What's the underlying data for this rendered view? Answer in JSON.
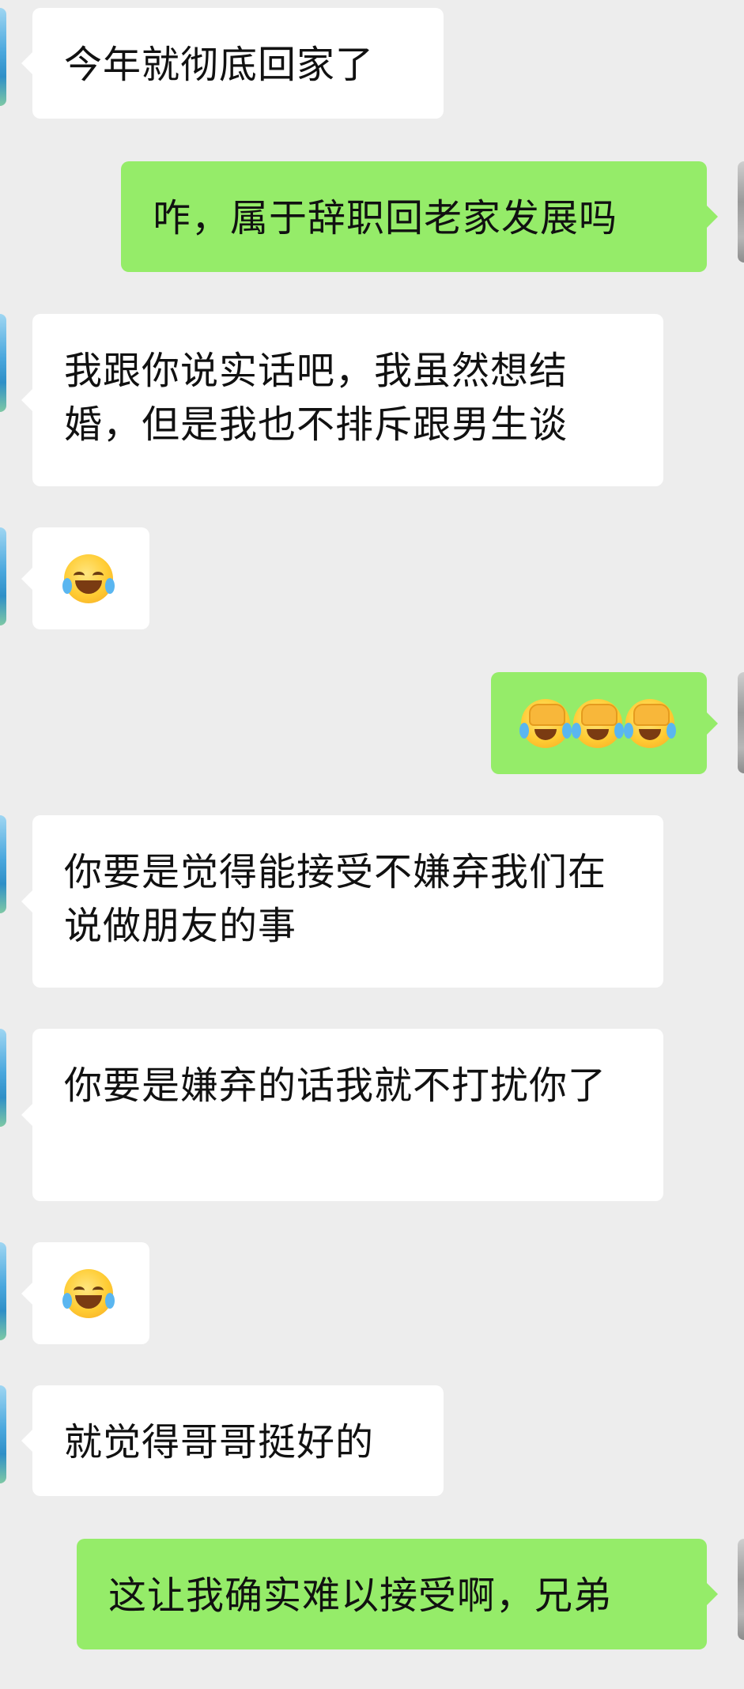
{
  "messages": [
    {
      "side": "in",
      "type": "text",
      "text": "今年就彻底回家了"
    },
    {
      "side": "out",
      "type": "text",
      "text": "咋，属于辞职回老家发展吗"
    },
    {
      "side": "in",
      "type": "text",
      "text": "我跟你说实话吧，我虽然想结婚，但是我也不排斥跟男生谈"
    },
    {
      "side": "in",
      "type": "emoji",
      "emoji": "tears-of-joy-emoji",
      "count": 1
    },
    {
      "side": "out",
      "type": "emoji",
      "emoji": "facepalm-crying-emoji",
      "count": 3
    },
    {
      "side": "in",
      "type": "text",
      "text": "你要是觉得能接受不嫌弃我们在说做朋友的事"
    },
    {
      "side": "in",
      "type": "text",
      "text": "你要是嫌弃的话我就不打扰你了"
    },
    {
      "side": "in",
      "type": "emoji",
      "emoji": "tears-of-joy-emoji",
      "count": 1
    },
    {
      "side": "in",
      "type": "text",
      "text": "就觉得哥哥挺好的"
    },
    {
      "side": "out",
      "type": "text",
      "text": "这让我确实难以接受啊，兄弟"
    }
  ],
  "colors": {
    "background": "#ededed",
    "incoming_bubble": "#ffffff",
    "outgoing_bubble": "#95ec69",
    "text": "#111111"
  }
}
